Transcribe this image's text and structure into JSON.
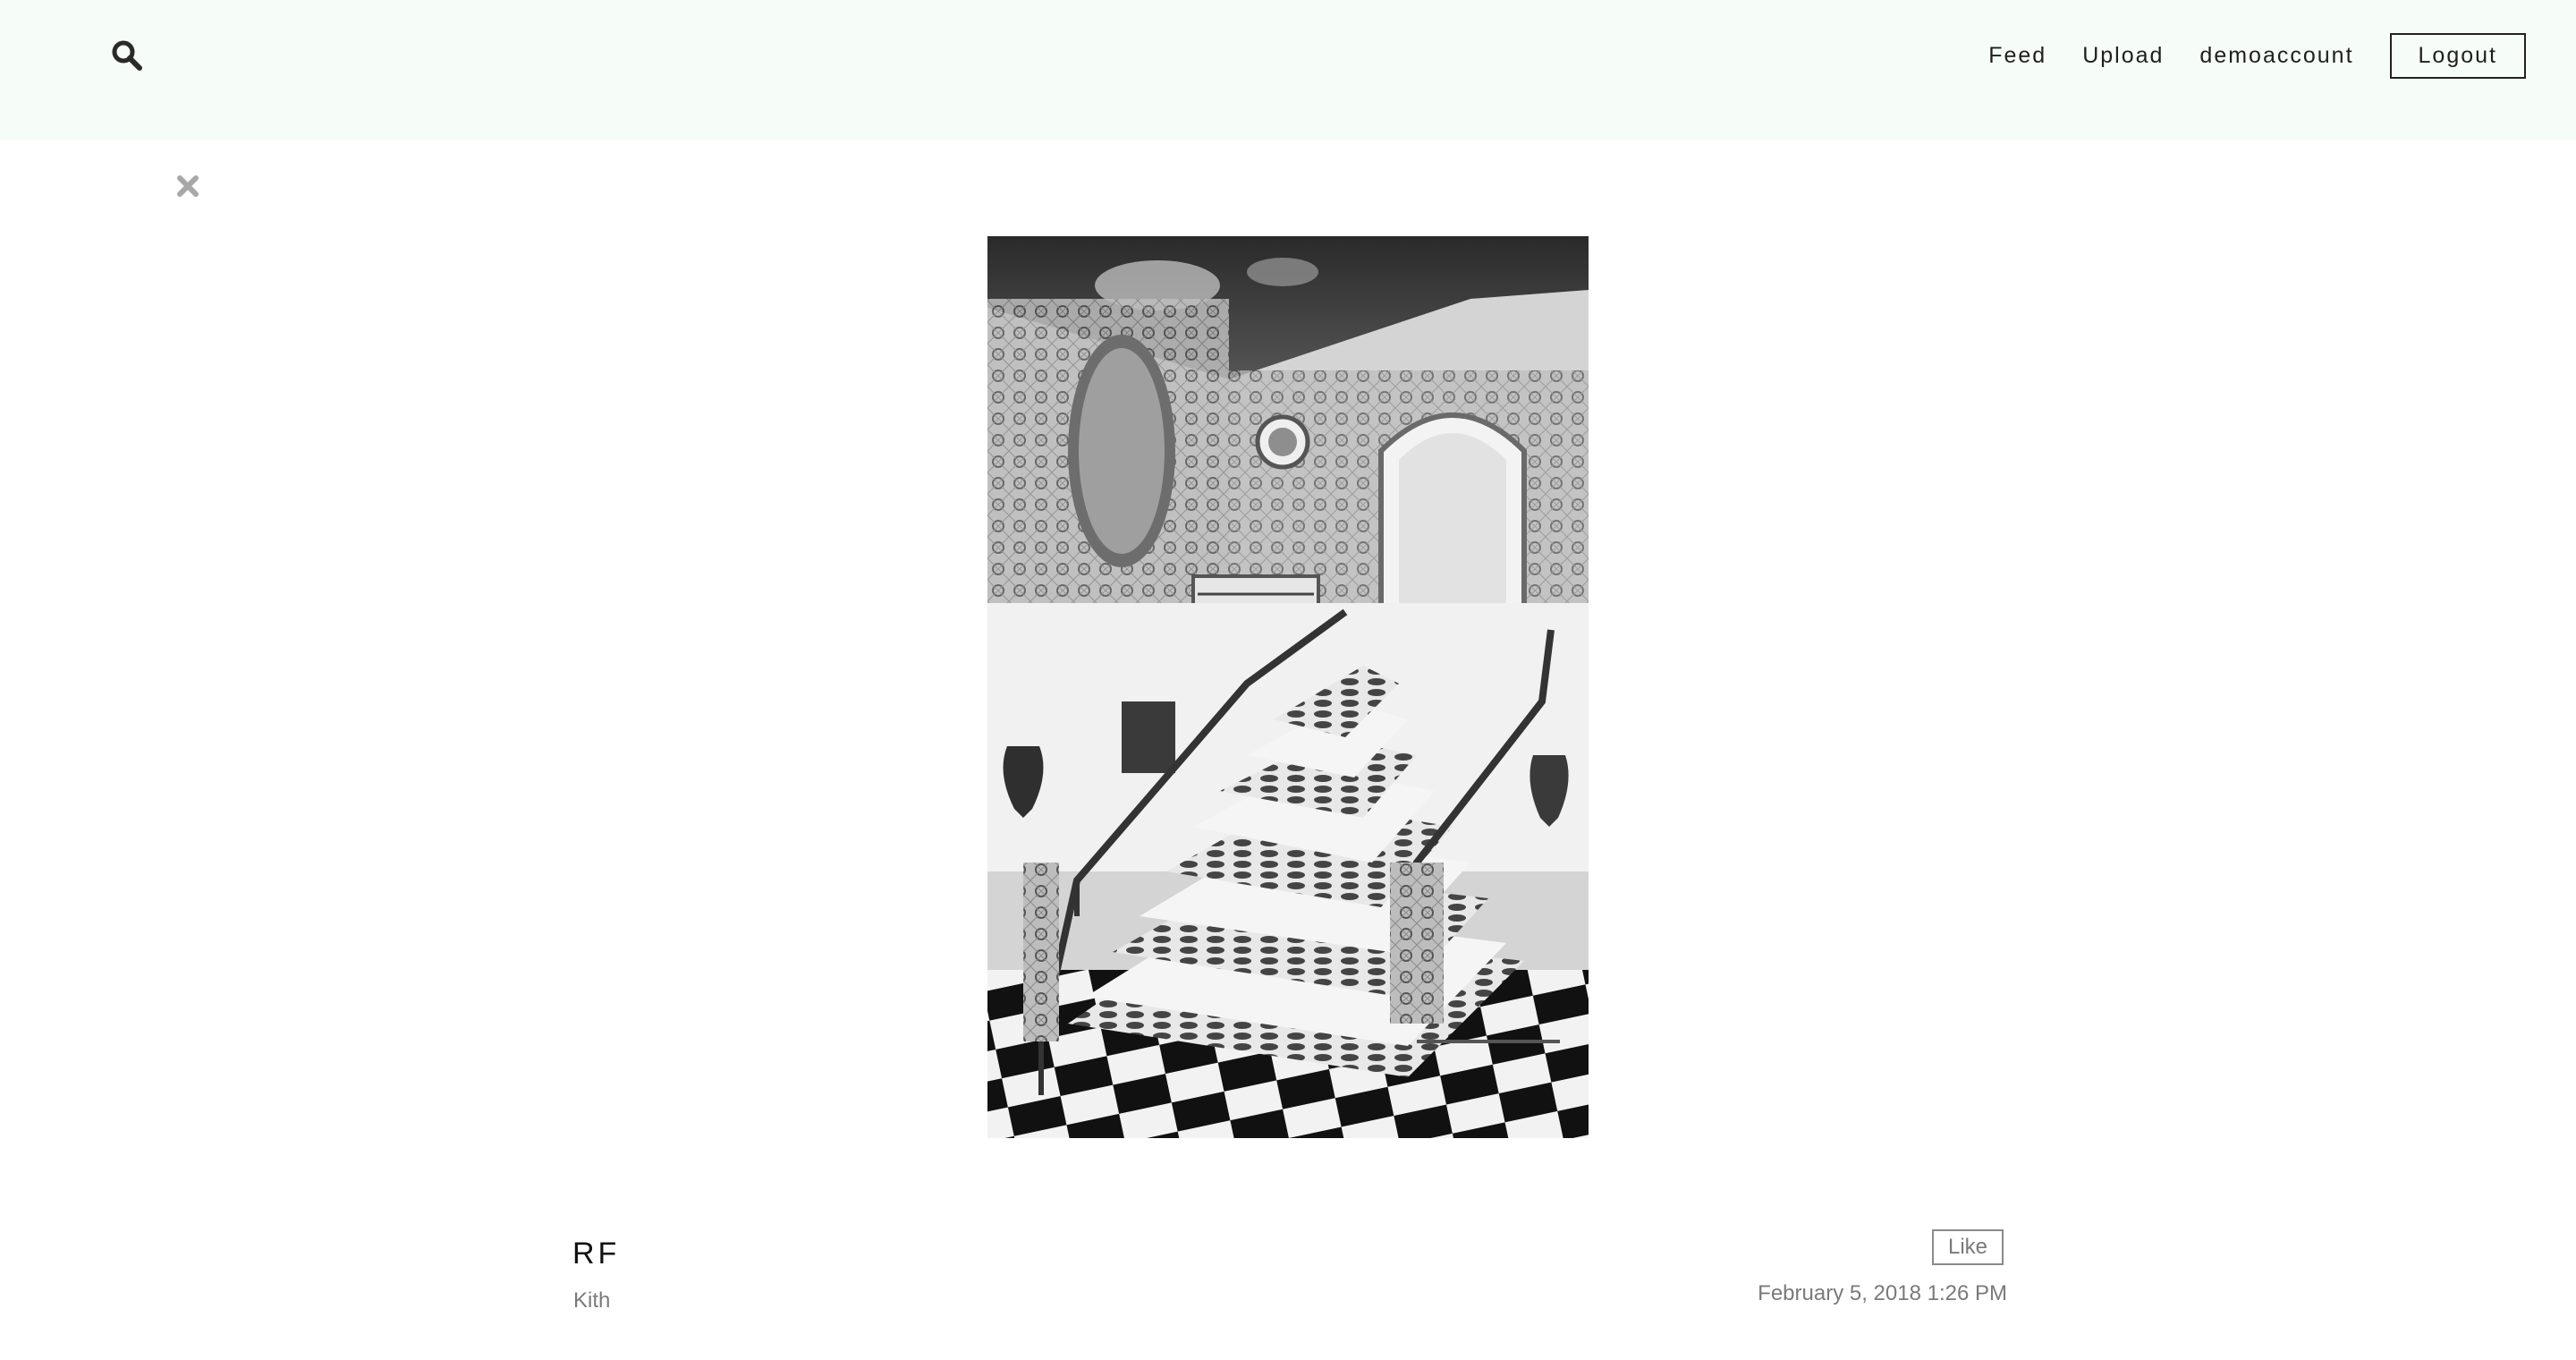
{
  "header": {
    "search_icon": "search-icon",
    "nav": {
      "feed_label": "Feed",
      "upload_label": "Upload",
      "account_label": "demoaccount",
      "logout_label": "Logout"
    },
    "background": "#f6fcf8"
  },
  "viewer": {
    "close_icon": "close-icon",
    "photo": {
      "subject": "grand-staircase-monochrome"
    }
  },
  "post": {
    "title": "RF",
    "user": "Kith",
    "like_label": "Like",
    "date": "February 5, 2018 1:26 PM"
  }
}
